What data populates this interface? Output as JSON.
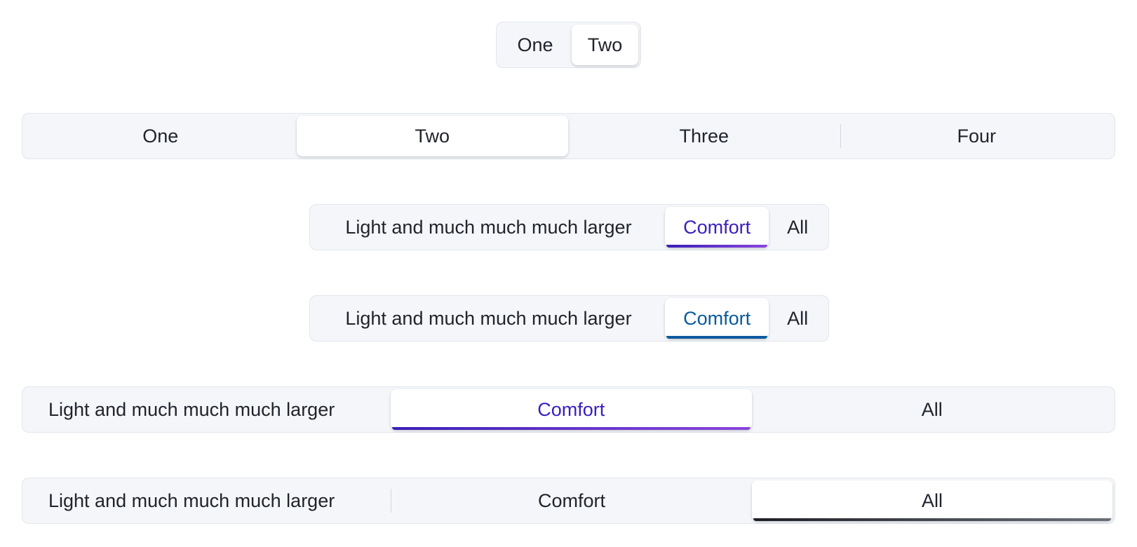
{
  "colors": {
    "background": "#ffffff",
    "segment_background": "#f4f6f9",
    "segment_border": "#e2e6ec",
    "selected_background": "#ffffff",
    "accent_purple": "#3b1fbf",
    "accent_purple_light": "#8a45dd",
    "accent_blue": "#0a5a9c",
    "accent_dark": "#1d1f24",
    "text": "#21242c"
  },
  "row1": {
    "options": [
      "One",
      "Two"
    ],
    "selected": "Two"
  },
  "row2": {
    "options": [
      "One",
      "Two",
      "Three",
      "Four"
    ],
    "selected": "Two"
  },
  "row3": {
    "options": [
      "Light and much much much larger",
      "Comfort",
      "All"
    ],
    "selected": "Comfort",
    "indicator": "purple-gradient"
  },
  "row4": {
    "options": [
      "Light and much much much larger",
      "Comfort",
      "All"
    ],
    "selected": "Comfort",
    "indicator": "blue"
  },
  "row5": {
    "options": [
      "Light and much much much larger",
      "Comfort",
      "All"
    ],
    "selected": "Comfort",
    "indicator": "purple-gradient"
  },
  "row6": {
    "options": [
      "Light and much much much larger",
      "Comfort",
      "All"
    ],
    "selected": "All",
    "indicator": "dark-gradient"
  }
}
